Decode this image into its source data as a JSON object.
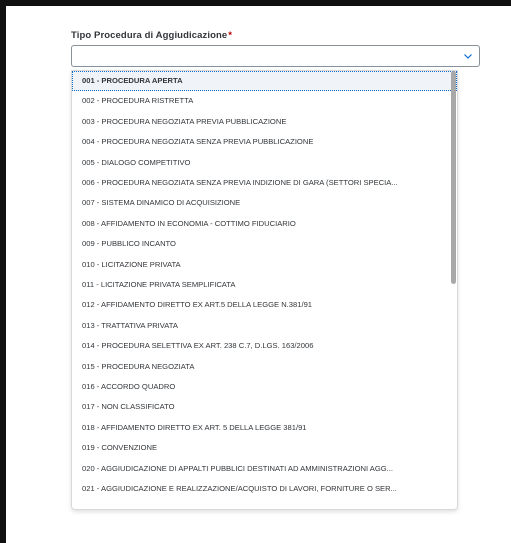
{
  "field": {
    "label": "Tipo Procedura di Aggiudicazione",
    "required_mark": "*",
    "value": ""
  },
  "icons": {
    "dropdown": "chevron-down-icon"
  },
  "colors": {
    "required": "#bb0000",
    "focus_outline": "#0a6ed1",
    "text": "#32363a"
  },
  "options": [
    {
      "label": "001 - PROCEDURA APERTA",
      "selected": true
    },
    {
      "label": "002 - PROCEDURA RISTRETTA"
    },
    {
      "label": "003 - PROCEDURA NEGOZIATA PREVIA PUBBLICAZIONE"
    },
    {
      "label": "004 - PROCEDURA NEGOZIATA SENZA PREVIA PUBBLICAZIONE"
    },
    {
      "label": "005 - DIALOGO COMPETITIVO"
    },
    {
      "label": "006 - PROCEDURA NEGOZIATA SENZA PREVIA INDIZIONE DI GARA (SETTORI SPECIA..."
    },
    {
      "label": "007 - SISTEMA DINAMICO DI ACQUISIZIONE"
    },
    {
      "label": "008 - AFFIDAMENTO IN ECONOMIA - COTTIMO FIDUCIARIO"
    },
    {
      "label": "009 - PUBBLICO INCANTO"
    },
    {
      "label": "010 - LICITAZIONE PRIVATA"
    },
    {
      "label": "011 - LICITAZIONE PRIVATA SEMPLIFICATA"
    },
    {
      "label": "012 - AFFIDAMENTO DIRETTO EX ART.5 DELLA LEGGE N.381/91"
    },
    {
      "label": "013 - TRATTATIVA PRIVATA"
    },
    {
      "label": "014 - PROCEDURA SELETTIVA EX ART. 238 C.7, D.LGS. 163/2006"
    },
    {
      "label": "015 - PROCEDURA NEGOZIATA"
    },
    {
      "label": "016 - ACCORDO QUADRO"
    },
    {
      "label": "017 - NON CLASSIFICATO"
    },
    {
      "label": "018 - AFFIDAMENTO DIRETTO EX ART. 5 DELLA LEGGE 381/91"
    },
    {
      "label": "019 - CONVENZIONE"
    },
    {
      "label": "020 - AGGIUDICAZIONE DI APPALTI PUBBLICI DESTINATI AD AMMINISTRAZIONI AGG..."
    },
    {
      "label": "021 - AGGIUDICAZIONE E REALIZZAZIONE/ACQUISTO DI LAVORI, FORNITURE O SER..."
    }
  ]
}
